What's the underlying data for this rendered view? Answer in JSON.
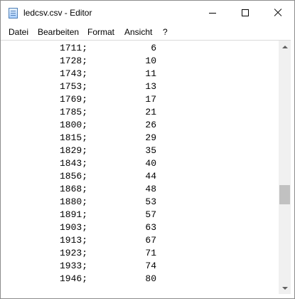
{
  "window": {
    "title": "ledcsv.csv - Editor",
    "icon": "notepad-icon"
  },
  "menu": {
    "items": [
      "Datei",
      "Bearbeiten",
      "Format",
      "Ansicht",
      "?"
    ]
  },
  "content": {
    "rows": [
      [
        "1711;",
        "6"
      ],
      [
        "1728;",
        "10"
      ],
      [
        "1743;",
        "11"
      ],
      [
        "1753;",
        "13"
      ],
      [
        "1769;",
        "17"
      ],
      [
        "1785;",
        "21"
      ],
      [
        "1800;",
        "26"
      ],
      [
        "1815;",
        "29"
      ],
      [
        "1829;",
        "35"
      ],
      [
        "1843;",
        "40"
      ],
      [
        "1856;",
        "44"
      ],
      [
        "1868;",
        "48"
      ],
      [
        "1880;",
        "53"
      ],
      [
        "1891;",
        "57"
      ],
      [
        "1903;",
        "63"
      ],
      [
        "1913;",
        "67"
      ],
      [
        "1923;",
        "71"
      ],
      [
        "1933;",
        "74"
      ],
      [
        "1946;",
        "80"
      ]
    ]
  },
  "scrollbar": {
    "position_fraction": 0.63
  }
}
